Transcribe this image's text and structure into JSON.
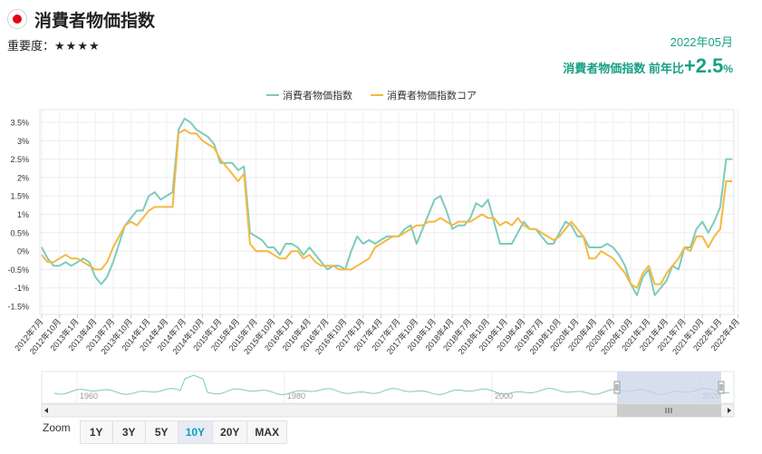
{
  "header": {
    "title": "消費者物価指数",
    "importance_label": "重要度：",
    "importance_stars": "★★★★",
    "date": "2022年05月",
    "yoy_label": "消費者物価指数 前年比",
    "yoy_value": "+2.5",
    "yoy_unit": "%"
  },
  "colors": {
    "headline": "#7ccbbd",
    "core": "#f4b942",
    "accent": "#199f86"
  },
  "zoom": {
    "label": "Zoom",
    "buttons": [
      "1Y",
      "3Y",
      "5Y",
      "10Y",
      "20Y",
      "MAX"
    ],
    "active": "10Y"
  },
  "navigator": {
    "labels": [
      "1960",
      "1980",
      "2000",
      "2020"
    ]
  },
  "chart_data": {
    "type": "line",
    "legend": {
      "position": "top-center"
    },
    "grid": true,
    "y_ticks": [
      "3.5%",
      "3%",
      "2.5%",
      "2%",
      "1.5%",
      "1%",
      "0.5%",
      "0%",
      "-0.5%",
      "-1%",
      "-1.5%"
    ],
    "ylim": [
      -1.5,
      3.5
    ],
    "x_ticks": [
      "2012年7月",
      "2012年10月",
      "2013年1月",
      "2013年4月",
      "2013年7月",
      "2013年10月",
      "2014年1月",
      "2014年4月",
      "2014年7月",
      "2014年10月",
      "2015年1月",
      "2015年4月",
      "2015年7月",
      "2015年10月",
      "2016年1月",
      "2016年4月",
      "2016年7月",
      "2016年10月",
      "2017年1月",
      "2017年4月",
      "2017年7月",
      "2017年10月",
      "2018年1月",
      "2018年4月",
      "2018年7月",
      "2018年10月",
      "2019年1月",
      "2019年4月",
      "2019年7月",
      "2019年10月",
      "2020年1月",
      "2020年4月",
      "2020年7月",
      "2020年10月",
      "2021年1月",
      "2021年4月",
      "2021年7月",
      "2021年10月",
      "2022年1月",
      "2022年4月"
    ],
    "series": [
      {
        "name": "消費者物価指数",
        "values": [
          0.1,
          -0.2,
          -0.4,
          -0.4,
          -0.3,
          -0.4,
          -0.3,
          -0.2,
          -0.3,
          -0.7,
          -0.9,
          -0.7,
          -0.3,
          0.2,
          0.7,
          0.9,
          1.1,
          1.1,
          1.5,
          1.6,
          1.4,
          1.5,
          1.6,
          3.3,
          3.6,
          3.5,
          3.3,
          3.2,
          3.1,
          2.9,
          2.4,
          2.4,
          2.4,
          2.2,
          2.3,
          0.5,
          0.4,
          0.3,
          0.1,
          0.1,
          -0.1,
          0.2,
          0.2,
          0.1,
          -0.1,
          0.1,
          -0.1,
          -0.3,
          -0.5,
          -0.4,
          -0.4,
          -0.5,
          0.0,
          0.4,
          0.2,
          0.3,
          0.2,
          0.3,
          0.4,
          0.4,
          0.4,
          0.6,
          0.7,
          0.2,
          0.6,
          1.0,
          1.4,
          1.5,
          1.1,
          0.6,
          0.7,
          0.7,
          0.9,
          1.3,
          1.2,
          1.4,
          0.8,
          0.2,
          0.2,
          0.2,
          0.5,
          0.8,
          0.6,
          0.6,
          0.4,
          0.2,
          0.2,
          0.5,
          0.8,
          0.7,
          0.4,
          0.4,
          0.1,
          0.1,
          0.1,
          0.2,
          0.1,
          -0.1,
          -0.4,
          -0.9,
          -1.2,
          -0.7,
          -0.5,
          -1.2,
          -1.0,
          -0.8,
          -0.4,
          -0.5,
          0.1,
          0.1,
          0.6,
          0.8,
          0.5,
          0.8,
          1.2,
          2.5,
          2.5
        ]
      },
      {
        "name": "消費者物価指数コア",
        "values": [
          -0.1,
          -0.3,
          -0.3,
          -0.2,
          -0.1,
          -0.2,
          -0.2,
          -0.3,
          -0.4,
          -0.5,
          -0.5,
          -0.3,
          0.1,
          0.4,
          0.7,
          0.8,
          0.7,
          0.9,
          1.1,
          1.2,
          1.2,
          1.2,
          1.2,
          3.2,
          3.3,
          3.2,
          3.2,
          3.0,
          2.9,
          2.8,
          2.5,
          2.3,
          2.1,
          1.9,
          2.1,
          0.2,
          0.0,
          0.0,
          0.0,
          -0.1,
          -0.2,
          -0.2,
          0.0,
          0.0,
          -0.2,
          -0.1,
          -0.3,
          -0.4,
          -0.4,
          -0.4,
          -0.5,
          -0.5,
          -0.5,
          -0.4,
          -0.3,
          -0.2,
          0.1,
          0.2,
          0.3,
          0.4,
          0.4,
          0.5,
          0.6,
          0.7,
          0.7,
          0.8,
          0.8,
          0.9,
          0.8,
          0.7,
          0.8,
          0.8,
          0.8,
          0.9,
          1.0,
          0.9,
          0.9,
          0.7,
          0.8,
          0.7,
          0.9,
          0.7,
          0.6,
          0.6,
          0.5,
          0.4,
          0.3,
          0.4,
          0.6,
          0.8,
          0.6,
          0.4,
          -0.2,
          -0.2,
          0.0,
          -0.1,
          -0.2,
          -0.4,
          -0.6,
          -0.9,
          -1.0,
          -0.6,
          -0.4,
          -0.9,
          -0.9,
          -0.6,
          -0.4,
          -0.2,
          0.1,
          0.0,
          0.4,
          0.4,
          0.1,
          0.4,
          0.6,
          1.9,
          1.9
        ]
      }
    ]
  }
}
